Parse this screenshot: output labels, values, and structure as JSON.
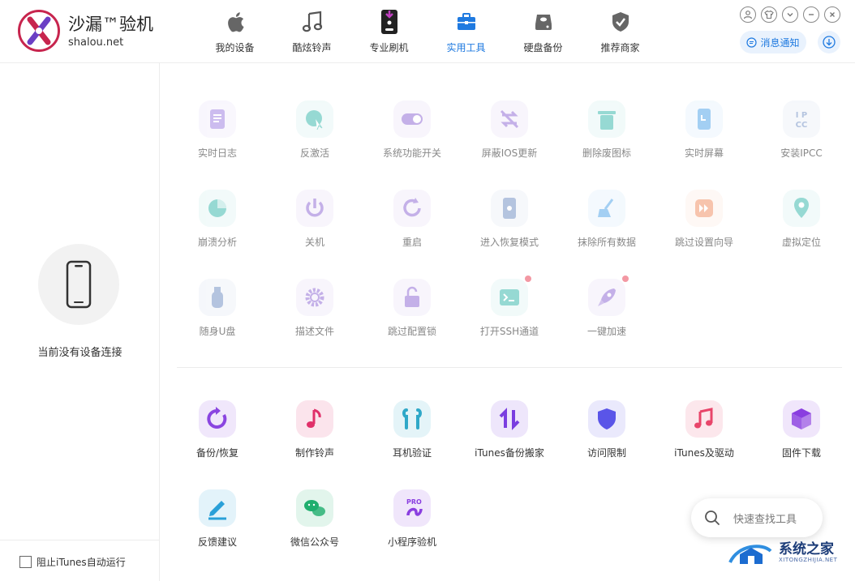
{
  "app": {
    "logo_title": "沙漏™验机",
    "logo_sub": "shalou.net"
  },
  "nav": [
    {
      "label": "我的设备",
      "icon": "apple-icon"
    },
    {
      "label": "酷炫铃声",
      "icon": "music-note-icon"
    },
    {
      "label": "专业刷机",
      "icon": "phone-flash-icon"
    },
    {
      "label": "实用工具",
      "icon": "toolbox-icon",
      "active": true
    },
    {
      "label": "硬盘备份",
      "icon": "hard-disk-icon"
    },
    {
      "label": "推荐商家",
      "icon": "shield-check-icon"
    }
  ],
  "header": {
    "notify_label": "消息通知"
  },
  "sidebar": {
    "no_device_text": "当前没有设备连接",
    "itunes_checkbox_label": "阻止iTunes自动运行"
  },
  "tools_device": [
    {
      "label": "实时日志",
      "icon": "log-icon",
      "color": "#9b7be0"
    },
    {
      "label": "反激活",
      "icon": "deactivate-icon",
      "color": "#2fb5a8"
    },
    {
      "label": "系统功能开关",
      "icon": "toggle-icon",
      "color": "#8a63d2"
    },
    {
      "label": "屏蔽IOS更新",
      "icon": "block-update-icon",
      "color": "#8a63d2"
    },
    {
      "label": "删除废图标",
      "icon": "trash-icon",
      "color": "#2fb5a8"
    },
    {
      "label": "实时屏幕",
      "icon": "screen-icon",
      "color": "#4aa0e8"
    },
    {
      "label": "安装IPCC",
      "icon": "ipcc-icon",
      "color": "#6c8ac0"
    },
    {
      "label": "崩溃分析",
      "icon": "pie-icon",
      "color": "#2fb5a8"
    },
    {
      "label": "关机",
      "icon": "power-icon",
      "color": "#8a63d2"
    },
    {
      "label": "重启",
      "icon": "restart-icon",
      "color": "#8a63d2"
    },
    {
      "label": "进入恢复模式",
      "icon": "recovery-icon",
      "color": "#6c8ac0"
    },
    {
      "label": "抹除所有数据",
      "icon": "broom-icon",
      "color": "#4aa0e8"
    },
    {
      "label": "跳过设置向导",
      "icon": "skip-icon",
      "color": "#f08a5d"
    },
    {
      "label": "虚拟定位",
      "icon": "location-pin-icon",
      "color": "#2fb5a8"
    },
    {
      "label": "随身U盘",
      "icon": "usb-icon",
      "color": "#6c8ac0"
    },
    {
      "label": "描述文件",
      "icon": "gear-icon",
      "color": "#8a63d2"
    },
    {
      "label": "跳过配置锁",
      "icon": "unlock-icon",
      "color": "#8a63d2"
    },
    {
      "label": "打开SSH通道",
      "icon": "terminal-icon",
      "color": "#2fb5a8",
      "dot": true
    },
    {
      "label": "一键加速",
      "icon": "rocket-icon",
      "color": "#8a63d2",
      "dot": true
    }
  ],
  "tools_general": [
    {
      "label": "备份/恢复",
      "icon": "backup-icon",
      "color": "#8a45e0"
    },
    {
      "label": "制作铃声",
      "icon": "ringtone-icon",
      "color": "#e0306a"
    },
    {
      "label": "耳机验证",
      "icon": "airpods-icon",
      "color": "#2fa8c8"
    },
    {
      "label": "iTunes备份搬家",
      "icon": "transfer-icon",
      "color": "#7a3ee0"
    },
    {
      "label": "访问限制",
      "icon": "shield-icon",
      "color": "#5a55e8"
    },
    {
      "label": "iTunes及驱动",
      "icon": "itunes-icon",
      "color": "#e8456a"
    },
    {
      "label": "固件下载",
      "icon": "cube-icon",
      "color": "#8a3ee0"
    },
    {
      "label": "反馈建议",
      "icon": "pencil-icon",
      "color": "#2aa0d8"
    },
    {
      "label": "微信公众号",
      "icon": "wechat-icon",
      "color": "#1fae6e"
    },
    {
      "label": "小程序验机",
      "icon": "miniprogram-icon",
      "color": "#8a3ee0"
    }
  ],
  "search": {
    "placeholder": "快速查找工具"
  },
  "watermark": {
    "text": "系统之家",
    "sub": "XITONGZHIJIA.NET"
  }
}
